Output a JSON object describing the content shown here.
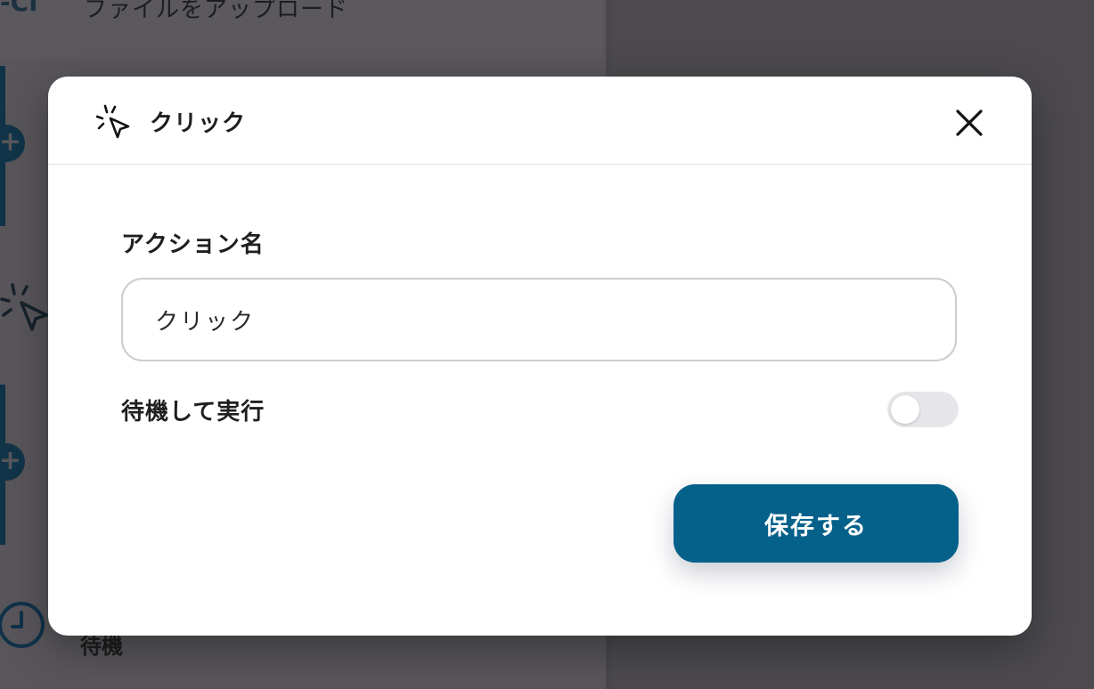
{
  "background": {
    "top_card_text": "ファイルをアップロード",
    "top_card_glyph": "-CI",
    "plus_glyph": "+",
    "wait_step_label": "待機"
  },
  "modal": {
    "title": "クリック",
    "header_icon": "click-pointer-icon",
    "close_icon": "close-icon",
    "action_name_label": "アクション名",
    "action_name_value": "クリック",
    "wait_and_run_label": "待機して実行",
    "wait_and_run_enabled": false,
    "save_label": "保存する"
  },
  "colors": {
    "accent": "#05618a",
    "overlay": "#4f4d51",
    "toggle_off": "#e6e5e9"
  }
}
